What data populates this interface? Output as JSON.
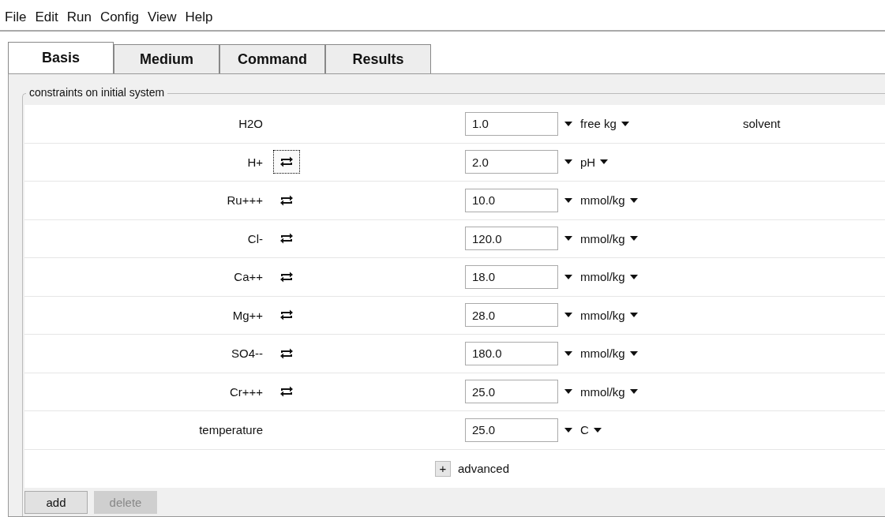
{
  "menu": [
    "File",
    "Edit",
    "Run",
    "Config",
    "View",
    "Help"
  ],
  "tabs": [
    {
      "label": "Basis",
      "selected": true
    },
    {
      "label": "Medium",
      "selected": false
    },
    {
      "label": "Command",
      "selected": false
    },
    {
      "label": "Results",
      "selected": false
    }
  ],
  "group": {
    "title": "constraints on initial system"
  },
  "rows": [
    {
      "name": "H2O",
      "swappable": false,
      "focused": false,
      "value": "1.0",
      "unit": "free kg",
      "note": "solvent"
    },
    {
      "name": "H+",
      "swappable": true,
      "focused": true,
      "value": "2.0",
      "unit": "pH"
    },
    {
      "name": "Ru+++",
      "swappable": true,
      "focused": false,
      "value": "10.0",
      "unit": "mmol/kg"
    },
    {
      "name": "Cl-",
      "swappable": true,
      "focused": false,
      "value": "120.0",
      "unit": "mmol/kg"
    },
    {
      "name": "Ca++",
      "swappable": true,
      "focused": false,
      "value": "18.0",
      "unit": "mmol/kg"
    },
    {
      "name": "Mg++",
      "swappable": true,
      "focused": false,
      "value": "28.0",
      "unit": "mmol/kg"
    },
    {
      "name": "SO4--",
      "swappable": true,
      "focused": false,
      "value": "180.0",
      "unit": "mmol/kg"
    },
    {
      "name": "Cr+++",
      "swappable": true,
      "focused": false,
      "value": "25.0",
      "unit": "mmol/kg"
    },
    {
      "name": "temperature",
      "swappable": false,
      "focused": false,
      "value": "25.0",
      "unit": "C"
    }
  ],
  "advanced": {
    "toggle": "+",
    "label": "advanced"
  },
  "buttons": [
    {
      "label": "add",
      "disabled": false
    },
    {
      "label": "delete",
      "disabled": true
    }
  ]
}
